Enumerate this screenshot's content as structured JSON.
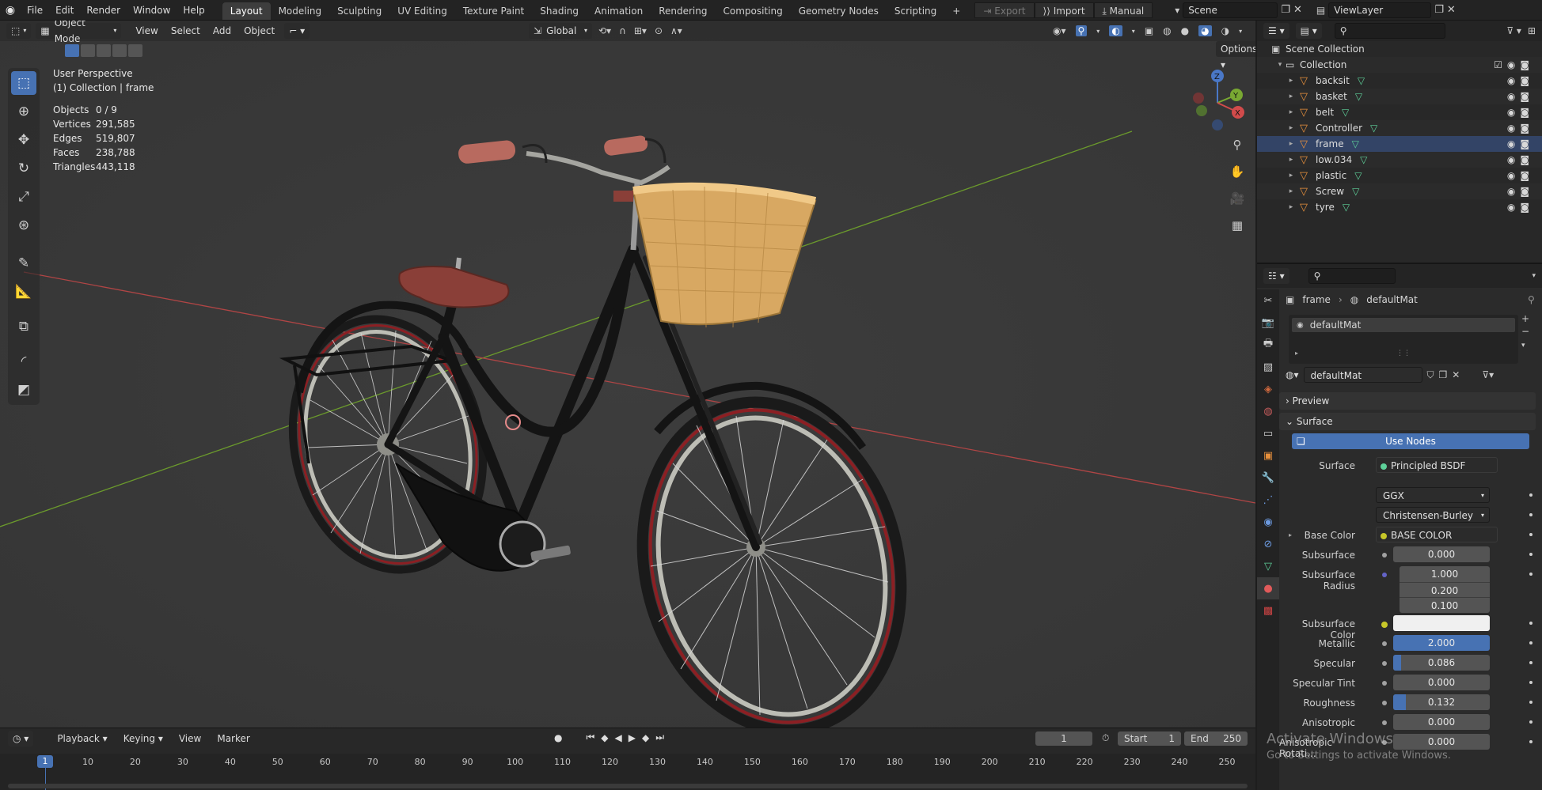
{
  "topbar": {
    "menus": [
      "File",
      "Edit",
      "Render",
      "Window",
      "Help"
    ],
    "workspaces": [
      "Layout",
      "Modeling",
      "Sculpting",
      "UV Editing",
      "Texture Paint",
      "Shading",
      "Animation",
      "Rendering",
      "Compositing",
      "Geometry Nodes",
      "Scripting"
    ],
    "add_tab": "+",
    "export_label": "Export",
    "import_label": "Import",
    "manual_label": "Manual",
    "scene_label": "Scene",
    "viewlayer_label": "ViewLayer"
  },
  "viewport": {
    "mode": "Object Mode",
    "menus": [
      "View",
      "Select",
      "Add",
      "Object"
    ],
    "transform_orientation": "Global",
    "options_label": "Options",
    "overlay_title": "User Perspective",
    "overlay_subtitle": "(1) Collection | frame",
    "stats": [
      {
        "label": "Objects",
        "value": "0 / 9"
      },
      {
        "label": "Vertices",
        "value": "291,585"
      },
      {
        "label": "Edges",
        "value": "519,807"
      },
      {
        "label": "Faces",
        "value": "238,788"
      },
      {
        "label": "Triangles",
        "value": "443,118"
      }
    ],
    "gizmo": {
      "z": "Z",
      "y": "Y",
      "x": "X"
    }
  },
  "timeline": {
    "menus": [
      "Playback",
      "Keying",
      "View",
      "Marker"
    ],
    "current_frame": "1",
    "start_label": "Start",
    "start_value": "1",
    "end_label": "End",
    "end_value": "250",
    "ruler": [
      "1",
      "10",
      "20",
      "30",
      "40",
      "50",
      "60",
      "70",
      "80",
      "90",
      "100",
      "110",
      "120",
      "130",
      "140",
      "150",
      "160",
      "170",
      "180",
      "190",
      "200",
      "210",
      "220",
      "230",
      "240",
      "250"
    ]
  },
  "outliner": {
    "scene_collection": "Scene Collection",
    "collection": "Collection",
    "objects": [
      "backsit",
      "basket",
      "belt",
      "Controller",
      "frame",
      "low.034",
      "plastic",
      "Screw",
      "tyre"
    ]
  },
  "properties": {
    "breadcrumb_object": "frame",
    "breadcrumb_material": "defaultMat",
    "slot_name": "defaultMat",
    "material_name": "defaultMat",
    "preview_label": "Preview",
    "surface_label": "Surface",
    "use_nodes_label": "Use Nodes",
    "surface_shader_label": "Surface",
    "surface_shader_value": "Principled BSDF",
    "distribution": "GGX",
    "subsurface_method": "Christensen-Burley",
    "base_color_label": "Base Color",
    "base_color_value": "BASE COLOR",
    "subsurface_label": "Subsurface",
    "subsurface_value": "0.000",
    "subsurface_radius_label": "Subsurface Radius",
    "subsurface_radius": [
      "1.000",
      "0.200",
      "0.100"
    ],
    "subsurface_color_label": "Subsurface Color",
    "metallic_label": "Metallic",
    "metallic_value": "2.000",
    "specular_label": "Specular",
    "specular_value": "0.086",
    "specular_tint_label": "Specular Tint",
    "specular_tint_value": "0.000",
    "roughness_label": "Roughness",
    "roughness_value": "0.132",
    "anisotropic_label": "Anisotropic",
    "anisotropic_value": "0.000",
    "anisotropic_rotation_label": "Anisotropic Rotati...",
    "anisotropic_rotation_value": "0.000"
  },
  "watermark": {
    "title": "Activate Windows",
    "subtitle": "Go to Settings to activate Windows."
  },
  "colors": {
    "accent": "#4772b3",
    "viewport_bg": "#3a3a3a",
    "panel_bg": "#2b2b2b",
    "axis_x": "#b04545",
    "axis_y": "#6b9a2c",
    "bike_frame": "#141414",
    "basket": "#d8a862",
    "saddle": "#8a3f38",
    "tyre_red": "#8c1f23"
  }
}
